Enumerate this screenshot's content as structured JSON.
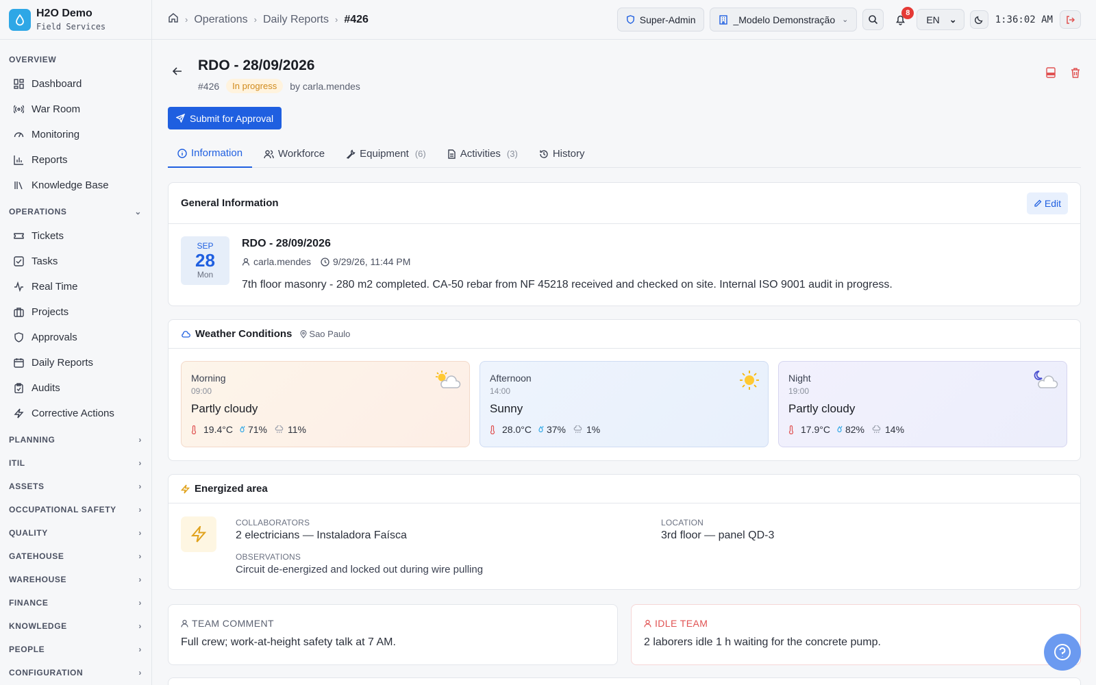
{
  "brand": {
    "name": "H2O Demo",
    "sub": "Field Services"
  },
  "sidebar": {
    "overview_title": "OVERVIEW",
    "overview": [
      {
        "label": "Dashboard",
        "icon": "dashboard-icon"
      },
      {
        "label": "War Room",
        "icon": "broadcast-icon"
      },
      {
        "label": "Monitoring",
        "icon": "gauge-icon"
      },
      {
        "label": "Reports",
        "icon": "bar-chart-icon"
      },
      {
        "label": "Knowledge Base",
        "icon": "library-icon"
      }
    ],
    "operations_title": "OPERATIONS",
    "operations": [
      {
        "label": "Tickets",
        "icon": "ticket-icon"
      },
      {
        "label": "Tasks",
        "icon": "checkbox-icon"
      },
      {
        "label": "Real Time",
        "icon": "activity-icon"
      },
      {
        "label": "Projects",
        "icon": "briefcase-icon"
      },
      {
        "label": "Approvals",
        "icon": "shield-icon"
      },
      {
        "label": "Daily Reports",
        "icon": "calendar-icon"
      },
      {
        "label": "Audits",
        "icon": "clipboard-icon"
      },
      {
        "label": "Corrective Actions",
        "icon": "lightning-icon"
      }
    ],
    "sections": [
      "PLANNING",
      "ITIL",
      "ASSETS",
      "OCCUPATIONAL SAFETY",
      "QUALITY",
      "GATEHOUSE",
      "WAREHOUSE",
      "FINANCE",
      "KNOWLEDGE",
      "PEOPLE",
      "CONFIGURATION"
    ]
  },
  "breadcrumb": [
    "Operations",
    "Daily Reports",
    "#426"
  ],
  "topbar": {
    "role": "Super-Admin",
    "tenant": "_Modelo Demonstração",
    "notifications": "8",
    "lang": "EN",
    "time": "1:36:02 AM"
  },
  "report": {
    "title": "RDO - 28/09/2026",
    "id": "#426",
    "status": "In progress",
    "by": "by carla.mendes",
    "submit_label": "Submit for Approval"
  },
  "tabs": [
    {
      "label": "Information",
      "count": ""
    },
    {
      "label": "Workforce",
      "count": ""
    },
    {
      "label": "Equipment",
      "count": "(6)"
    },
    {
      "label": "Activities",
      "count": "(3)"
    },
    {
      "label": "History",
      "count": ""
    }
  ],
  "general": {
    "heading": "General Information",
    "edit_label": "Edit",
    "month": "SEP",
    "day": "28",
    "weekday": "Mon",
    "title": "RDO - 28/09/2026",
    "user": "carla.mendes",
    "datetime": "9/29/26, 11:44 PM",
    "text": "7th floor masonry - 280 m2 completed. CA-50 rebar from NF 45218 received and checked on site. Internal ISO 9001 audit in progress."
  },
  "weather": {
    "heading": "Weather Conditions",
    "location": "Sao Paulo",
    "periods": [
      {
        "period": "Morning",
        "time": "09:00",
        "condition": "Partly cloudy",
        "temp": "19.4°C",
        "humidity": "71%",
        "rain": "11%",
        "icon": "partly-cloudy-icon"
      },
      {
        "period": "Afternoon",
        "time": "14:00",
        "condition": "Sunny",
        "temp": "28.0°C",
        "humidity": "37%",
        "rain": "1%",
        "icon": "sun-icon"
      },
      {
        "period": "Night",
        "time": "19:00",
        "condition": "Partly cloudy",
        "temp": "17.9°C",
        "humidity": "82%",
        "rain": "14%",
        "icon": "moon-cloud-icon"
      }
    ]
  },
  "energized": {
    "heading": "Energized area",
    "collaborators_label": "COLLABORATORS",
    "collaborators": "2 electricians — Instaladora Faísca",
    "location_label": "LOCATION",
    "location": "3rd floor — panel QD-3",
    "observations_label": "OBSERVATIONS",
    "observations": "Circuit de-energized and locked out during wire pulling"
  },
  "team_comment": {
    "label": "TEAM COMMENT",
    "text": "Full crew; work-at-height safety talk at 7 AM."
  },
  "idle_team": {
    "label": "IDLE TEAM",
    "text": "2 laborers idle 1 h waiting for the concrete pump."
  },
  "colors": {
    "accent": "#1f5fe0",
    "warning": "#d08a1c",
    "danger": "#e05252"
  }
}
